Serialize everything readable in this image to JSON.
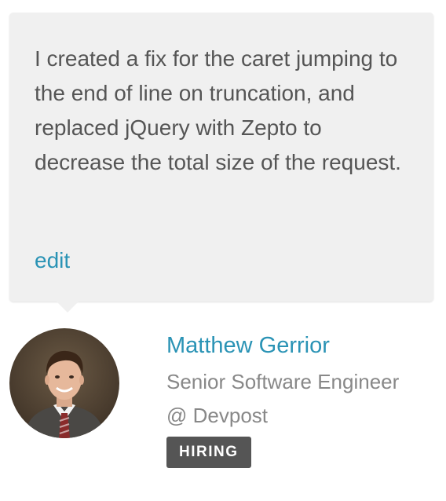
{
  "comment": {
    "text": "I created a fix for the caret jumping to the end of line on truncation, and replaced jQuery with Zepto to decrease the total size of the request.",
    "edit_label": "edit"
  },
  "author": {
    "name": "Matthew Gerrior",
    "title": "Senior Software Engineer",
    "company": "@ Devpost",
    "badge": "HIRING"
  },
  "colors": {
    "link": "#2a93b5",
    "bubble_bg": "#f0f0f0",
    "badge_bg": "#555555",
    "muted_text": "#888888"
  }
}
